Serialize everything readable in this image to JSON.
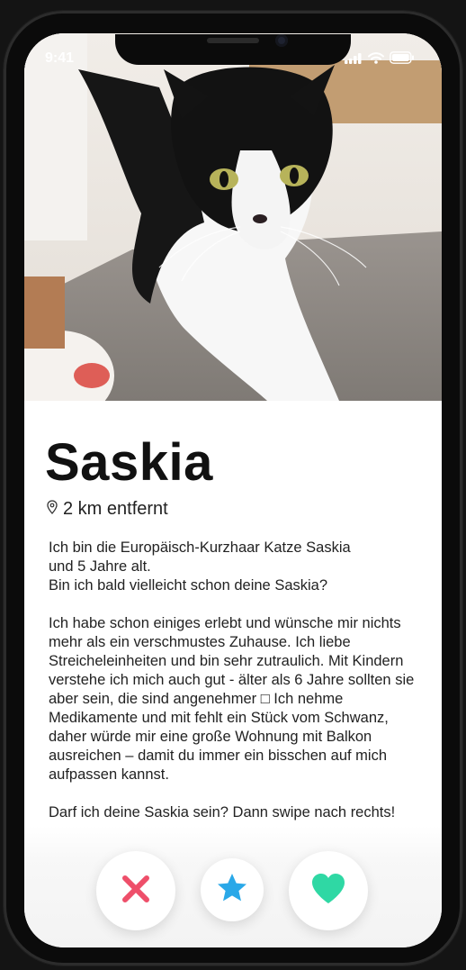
{
  "status_bar": {
    "time": "9:41",
    "icons": [
      "signal-icon",
      "wifi-icon",
      "battery-icon"
    ]
  },
  "profile": {
    "photo_subject": "black-and-white cat",
    "name": "Saskia",
    "distance": "2 km entfernt",
    "bio": [
      "Ich bin die Europäisch-Kurzhaar Katze Saskia\nund 5 Jahre alt.\nBin ich bald vielleicht schon deine Saskia?",
      "Ich habe schon einiges erlebt und wünsche mir nichts mehr als ein verschmustes Zuhause. Ich liebe Streicheleinheiten und bin sehr zutraulich. Mit Kindern verstehe ich mich auch gut - älter als 6 Jahre sollten sie aber sein, die sind angenehmer □ Ich nehme Medikamente und mit fehlt ein Stück vom Schwanz, daher würde mir eine große Wohnung mit Balkon ausreichen – damit du immer ein bisschen auf mich aufpassen kannst.",
      "Darf ich deine Saskia sein? Dann swipe nach rechts!"
    ]
  },
  "actions": {
    "nope_icon": "close-icon",
    "super_like_icon": "star-icon",
    "like_icon": "heart-icon"
  },
  "colors": {
    "nope": "#ee4f6a",
    "super_like": "#2aa8e8",
    "like": "#2fd8a4"
  }
}
